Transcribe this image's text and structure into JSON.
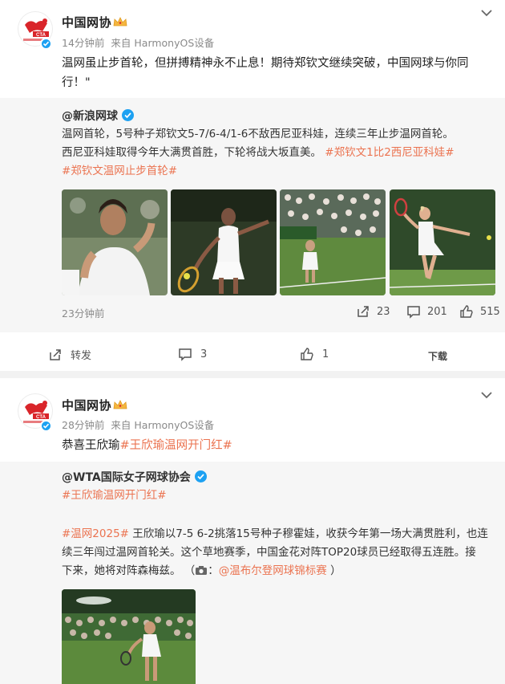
{
  "post1": {
    "author": "中国网协",
    "time": "14分钟前",
    "source": "来自 HarmonyOS设备",
    "text": "温网虽止步首轮，但拼搏精神永不止息！期待郑钦文继续突破，中国网球与你同行！\"",
    "repost": {
      "author": "@新浪网球",
      "text_lines": [
        "温网首轮，5号种子郑钦文5-7/6-4/1-6不敌西尼亚科娃，连续三年止步温网首轮。",
        "西尼亚科娃取得今年大满贯首胜，下轮将战大坂直美。"
      ],
      "hashtag1": "#郑钦文1比2西尼亚科娃#",
      "hashtag2": "#郑钦文温网止步首轮#",
      "time": "23分钟前",
      "reposts": "23",
      "comments": "201",
      "likes": "515"
    },
    "actions": {
      "repost": "转发",
      "comment": "3",
      "like": "1",
      "download": "下载"
    }
  },
  "post2": {
    "author": "中国网协",
    "time": "28分钟前",
    "source": "来自 HarmonyOS设备",
    "text_prefix": "恭喜王欣瑜",
    "hashtag": "#王欣瑜温网开门红#",
    "repost": {
      "author": "@WTA国际女子网球协会",
      "hashtag_top": "#王欣瑜温网开门红#",
      "hashtag_year": "#温网2025#",
      "line1": "王欣瑜以7-5 6-2挑落15号种子穆霍娃，收获今年第一场大满贯胜利，也连",
      "line2": "续三年闯过温网首轮关。这个草地赛季，中国金花对阵TOP20球员已经取得五连胜。接",
      "line3_prefix": "下来，她将对阵森梅兹。 （",
      "line3_link": "@温布尔登网球锦标赛",
      "line3_suffix": "）"
    }
  },
  "logo": {
    "text": "CTA",
    "subtext": "中国网球协会"
  },
  "colors": {
    "accent": "#eb7350",
    "verified": "#1da1f2",
    "logo_red": "#d9252a"
  },
  "icons": [
    "chevron-down-icon",
    "crown-icon",
    "repost-icon",
    "comment-icon",
    "like-icon",
    "camera-icon",
    "verified-icon"
  ]
}
